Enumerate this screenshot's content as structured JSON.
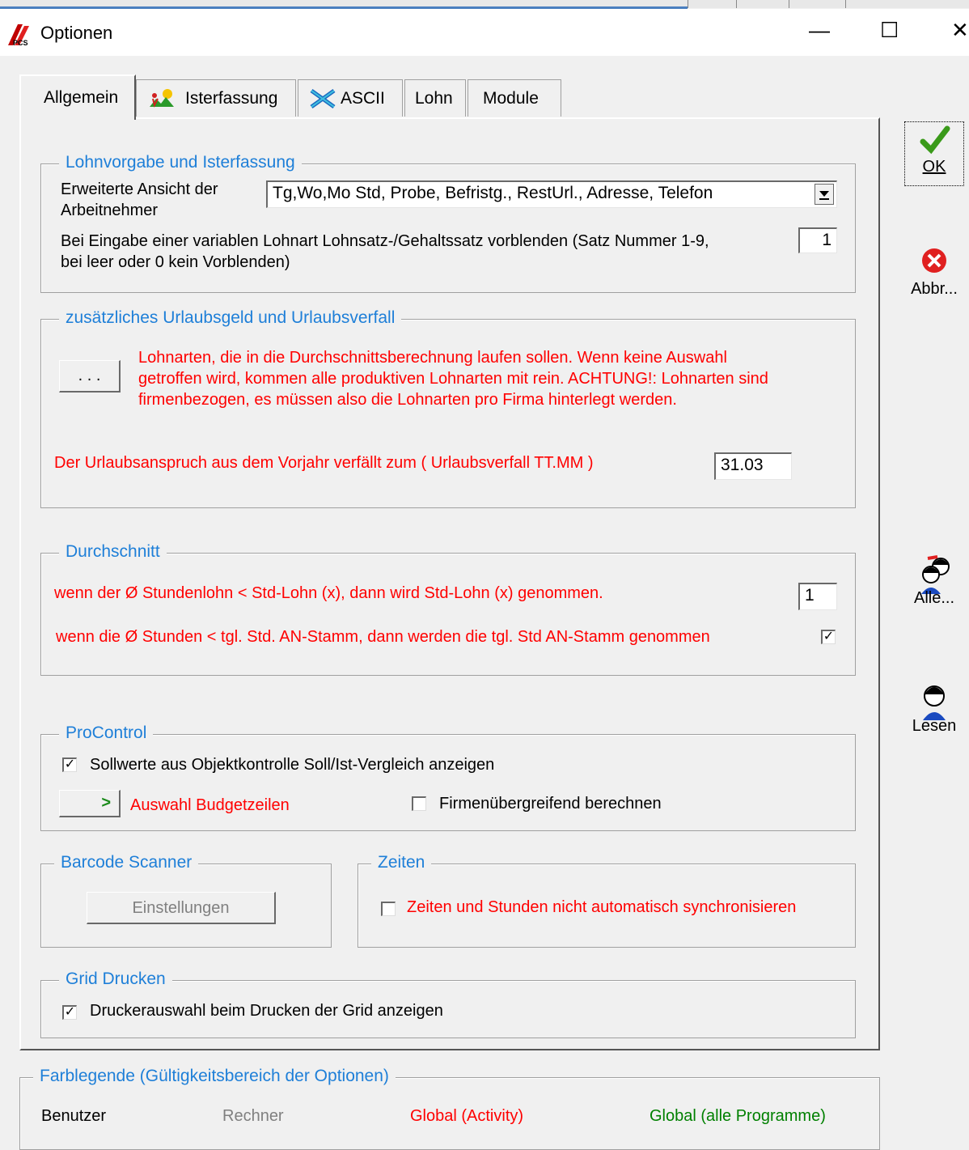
{
  "window": {
    "title": "Optionen",
    "minimize": "—",
    "maximize": "☐",
    "close": "✕"
  },
  "tabs": [
    {
      "label": "Allgemein"
    },
    {
      "label": "Isterfassung"
    },
    {
      "label": "ASCII"
    },
    {
      "label": "Lohn"
    },
    {
      "label": "Module"
    }
  ],
  "lohnvorgabe": {
    "legend": "Lohnvorgabe und Isterfassung",
    "erweiterte_label_1": "Erweiterte Ansicht der",
    "erweiterte_label_2": "Arbeitnehmer",
    "erweiterte_value": "Tg,Wo,Mo Std, Probe, Befristg., RestUrl., Adresse, Telefon",
    "variable_label_1": "Bei Eingabe einer variablen Lohnart Lohnsatz-/Gehaltssatz vorblenden (Satz Nummer 1-9,",
    "variable_label_2": "bei leer oder 0 kein Vorblenden)",
    "variable_value": "1"
  },
  "urlaub": {
    "legend": "zusätzliches Urlaubsgeld und Urlaubsverfall",
    "dots_button": ". . .",
    "info_1": "Lohnarten, die in die Durchschnittsberechnung laufen sollen. Wenn keine Auswahl",
    "info_2": "getroffen wird, kommen alle produktiven Lohnarten mit rein. ACHTUNG!: Lohnarten sind",
    "info_3": "firmenbezogen, es müssen also die Lohnarten pro Firma hinterlegt werden.",
    "verfall_label": "Der Urlaubsanspruch aus dem Vorjahr verfällt zum (  Urlaubsverfall TT.MM )",
    "verfall_value": "31.03"
  },
  "durchschnitt": {
    "legend": "Durchschnitt",
    "row1_label": "wenn der Ø Stundenlohn < Std-Lohn (x), dann wird Std-Lohn (x)  genommen.",
    "row1_value": "1",
    "row2_label": "wenn die Ø Stunden < tgl. Std. AN-Stamm, dann werden die tgl. Std AN-Stamm genommen",
    "row2_checked": true
  },
  "procontrol": {
    "legend": "ProControl",
    "sollwerte_label": "Sollwerte aus Objektkontrolle Soll/Ist-Vergleich anzeigen",
    "sollwerte_checked": true,
    "budget_button": ">",
    "budget_label": "Auswahl Budgetzeilen",
    "firmen_label": "Firmenübergreifend berechnen",
    "firmen_checked": false
  },
  "barcode": {
    "legend": "Barcode Scanner",
    "button": "Einstellungen"
  },
  "zeiten": {
    "legend": "Zeiten",
    "label": "Zeiten und Stunden nicht automatisch synchronisieren",
    "checked": false
  },
  "grid": {
    "legend": "Grid Drucken",
    "label": "Druckerauswahl beim Drucken der Grid anzeigen",
    "checked": true
  },
  "farblegende": {
    "legend": "Farblegende (Gültigkeitsbereich der Optionen)",
    "items": [
      {
        "label": "Benutzer",
        "color": "#000000"
      },
      {
        "label": "Rechner",
        "color": "#808080"
      },
      {
        "label": "Global (Activity)",
        "color": "#ff0000"
      },
      {
        "label": "Global (alle Programme)",
        "color": "#008000"
      }
    ]
  },
  "side_buttons": {
    "ok": "OK",
    "abbr": "Abbr...",
    "alle": "Alle...",
    "lesen": "Lesen"
  },
  "colors": {
    "legend_blue": "#1e7fd8",
    "warning_red": "#ff0000",
    "ok_green": "#3a9a1a",
    "cancel_red": "#e02020"
  }
}
